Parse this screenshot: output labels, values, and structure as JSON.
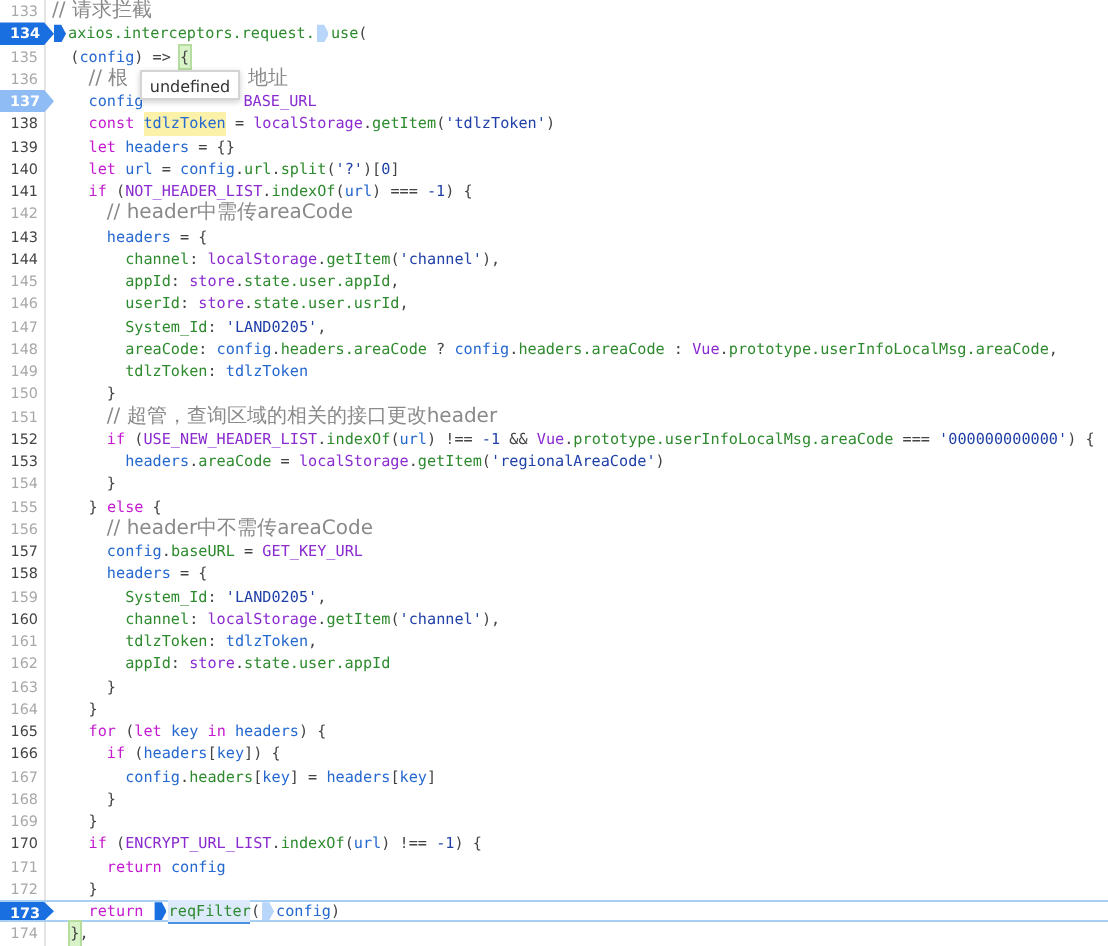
{
  "tooltip": {
    "text": "undefined"
  },
  "lines": [
    {
      "number": "133",
      "executable": false,
      "breakpoint": false,
      "current": false,
      "tokens": [
        {
          "kind": "c",
          "text": "// 请求拦截"
        }
      ]
    },
    {
      "number": "134",
      "executable": true,
      "breakpoint": true,
      "disabled": false,
      "current": false,
      "tokens": [
        {
          "kind": "marker",
          "on": true
        },
        {
          "kind": "p",
          "text": "axios.interceptors.request."
        },
        {
          "kind": "marker",
          "on": false
        },
        {
          "kind": "p",
          "text": "use"
        },
        {
          "kind": "o",
          "text": "("
        }
      ],
      "children": [
        {
          "number": "135",
          "executable": false,
          "breakpoint": false,
          "current": false,
          "tokens": [
            {
              "kind": "o",
              "text": "("
            },
            {
              "kind": "v",
              "text": "config"
            },
            {
              "kind": "o",
              "text": ") => "
            },
            {
              "kind": "bracket",
              "text": "{"
            }
          ],
          "children": [
            {
              "number": "136",
              "executable": false,
              "breakpoint": false,
              "current": false,
              "tokens": [
                {
                  "kind": "c",
                  "text": "// 根"
                },
                {
                  "kind": "gap"
                },
                {
                  "kind": "c",
                  "text": "地址"
                }
              ]
            },
            {
              "number": "137",
              "executable": true,
              "breakpoint": true,
              "disabled": true,
              "current": false,
              "tokens": [
                {
                  "kind": "v",
                  "text": "config"
                },
                {
                  "kind": "gap"
                },
                {
                  "kind": "g",
                  "text": "BASE_URL"
                }
              ]
            },
            {
              "number": "138",
              "executable": true,
              "breakpoint": false,
              "current": false,
              "tokens": [
                {
                  "kind": "k",
                  "text": "const "
                },
                {
                  "kind": "occurrence",
                  "text": "tdlzToken"
                },
                {
                  "kind": "o",
                  "text": " = "
                },
                {
                  "kind": "g",
                  "text": "localStorage"
                },
                {
                  "kind": "o",
                  "text": "."
                },
                {
                  "kind": "p",
                  "text": "getItem"
                },
                {
                  "kind": "o",
                  "text": "("
                },
                {
                  "kind": "s",
                  "text": "'tdlzToken'"
                },
                {
                  "kind": "o",
                  "text": ")"
                }
              ]
            },
            {
              "number": "139",
              "executable": true,
              "breakpoint": false,
              "current": false,
              "tokens": [
                {
                  "kind": "k",
                  "text": "let "
                },
                {
                  "kind": "v",
                  "text": "headers"
                },
                {
                  "kind": "o",
                  "text": " = {}"
                }
              ]
            },
            {
              "number": "140",
              "executable": true,
              "breakpoint": false,
              "current": false,
              "tokens": [
                {
                  "kind": "k",
                  "text": "let "
                },
                {
                  "kind": "v",
                  "text": "url"
                },
                {
                  "kind": "o",
                  "text": " = "
                },
                {
                  "kind": "v",
                  "text": "config"
                },
                {
                  "kind": "o",
                  "text": "."
                },
                {
                  "kind": "p",
                  "text": "url"
                },
                {
                  "kind": "o",
                  "text": "."
                },
                {
                  "kind": "p",
                  "text": "split"
                },
                {
                  "kind": "o",
                  "text": "("
                },
                {
                  "kind": "s",
                  "text": "'?'"
                },
                {
                  "kind": "o",
                  "text": ")["
                },
                {
                  "kind": "n",
                  "text": "0"
                },
                {
                  "kind": "o",
                  "text": "]"
                }
              ]
            },
            {
              "number": "141",
              "executable": true,
              "breakpoint": false,
              "current": false,
              "tokens": [
                {
                  "kind": "k",
                  "text": "if "
                },
                {
                  "kind": "o",
                  "text": "("
                },
                {
                  "kind": "g",
                  "text": "NOT_HEADER_LIST"
                },
                {
                  "kind": "o",
                  "text": "."
                },
                {
                  "kind": "p",
                  "text": "indexOf"
                },
                {
                  "kind": "o",
                  "text": "("
                },
                {
                  "kind": "v",
                  "text": "url"
                },
                {
                  "kind": "o",
                  "text": ") === "
                },
                {
                  "kind": "n",
                  "text": "-1"
                },
                {
                  "kind": "o",
                  "text": ") {"
                }
              ],
              "children": [
                {
                  "number": "142",
                  "executable": false,
                  "breakpoint": false,
                  "current": false,
                  "tokens": [
                    {
                      "kind": "c",
                      "text": "// header中需传areaCode"
                    }
                  ]
                },
                {
                  "number": "143",
                  "executable": true,
                  "breakpoint": false,
                  "current": false,
                  "tokens": [
                    {
                      "kind": "v",
                      "text": "headers"
                    },
                    {
                      "kind": "o",
                      "text": " = {"
                    }
                  ],
                  "children": [
                    {
                      "number": "144",
                      "executable": true,
                      "breakpoint": false,
                      "current": false,
                      "tokens": [
                        {
                          "kind": "p",
                          "text": "channel"
                        },
                        {
                          "kind": "o",
                          "text": ": "
                        },
                        {
                          "kind": "g",
                          "text": "localStorage"
                        },
                        {
                          "kind": "o",
                          "text": "."
                        },
                        {
                          "kind": "p",
                          "text": "getItem"
                        },
                        {
                          "kind": "o",
                          "text": "("
                        },
                        {
                          "kind": "s",
                          "text": "'channel'"
                        },
                        {
                          "kind": "o",
                          "text": "),"
                        }
                      ]
                    },
                    {
                      "number": "145",
                      "executable": false,
                      "breakpoint": false,
                      "current": false,
                      "tokens": [
                        {
                          "kind": "p",
                          "text": "appId"
                        },
                        {
                          "kind": "o",
                          "text": ": "
                        },
                        {
                          "kind": "g",
                          "text": "store"
                        },
                        {
                          "kind": "o",
                          "text": "."
                        },
                        {
                          "kind": "p",
                          "text": "state.user.appId"
                        },
                        {
                          "kind": "o",
                          "text": ","
                        }
                      ]
                    },
                    {
                      "number": "146",
                      "executable": false,
                      "breakpoint": false,
                      "current": false,
                      "tokens": [
                        {
                          "kind": "p",
                          "text": "userId"
                        },
                        {
                          "kind": "o",
                          "text": ": "
                        },
                        {
                          "kind": "g",
                          "text": "store"
                        },
                        {
                          "kind": "o",
                          "text": "."
                        },
                        {
                          "kind": "p",
                          "text": "state.user.usrId"
                        },
                        {
                          "kind": "o",
                          "text": ","
                        }
                      ]
                    },
                    {
                      "number": "147",
                      "executable": false,
                      "breakpoint": false,
                      "current": false,
                      "tokens": [
                        {
                          "kind": "p",
                          "text": "System_Id"
                        },
                        {
                          "kind": "o",
                          "text": ": "
                        },
                        {
                          "kind": "s",
                          "text": "'LAND0205'"
                        },
                        {
                          "kind": "o",
                          "text": ","
                        }
                      ]
                    },
                    {
                      "number": "148",
                      "executable": false,
                      "breakpoint": false,
                      "current": false,
                      "tokens": [
                        {
                          "kind": "p",
                          "text": "areaCode"
                        },
                        {
                          "kind": "o",
                          "text": ": "
                        },
                        {
                          "kind": "v",
                          "text": "config"
                        },
                        {
                          "kind": "o",
                          "text": "."
                        },
                        {
                          "kind": "p",
                          "text": "headers.areaCode"
                        },
                        {
                          "kind": "o",
                          "text": " ? "
                        },
                        {
                          "kind": "v",
                          "text": "config"
                        },
                        {
                          "kind": "o",
                          "text": "."
                        },
                        {
                          "kind": "p",
                          "text": "headers.areaCode"
                        },
                        {
                          "kind": "o",
                          "text": " : "
                        },
                        {
                          "kind": "g",
                          "text": "Vue"
                        },
                        {
                          "kind": "o",
                          "text": "."
                        },
                        {
                          "kind": "p",
                          "text": "prototype.userInfoLocalMsg.areaCode"
                        },
                        {
                          "kind": "o",
                          "text": ","
                        }
                      ]
                    },
                    {
                      "number": "149",
                      "executable": false,
                      "breakpoint": false,
                      "current": false,
                      "tokens": [
                        {
                          "kind": "p",
                          "text": "tdlzToken"
                        },
                        {
                          "kind": "o",
                          "text": ": "
                        },
                        {
                          "kind": "v",
                          "text": "tdlzToken"
                        }
                      ]
                    }
                  ]
                },
                {
                  "number": "150",
                  "executable": false,
                  "breakpoint": false,
                  "current": false,
                  "tokens": [
                    {
                      "kind": "o",
                      "text": "}"
                    }
                  ]
                },
                {
                  "number": "151",
                  "executable": false,
                  "breakpoint": false,
                  "current": false,
                  "tokens": [
                    {
                      "kind": "c",
                      "text": "// 超管，查询区域的相关的接口更改header"
                    }
                  ]
                },
                {
                  "number": "152",
                  "executable": true,
                  "breakpoint": false,
                  "current": false,
                  "tokens": [
                    {
                      "kind": "k",
                      "text": "if "
                    },
                    {
                      "kind": "o",
                      "text": "("
                    },
                    {
                      "kind": "g",
                      "text": "USE_NEW_HEADER_LIST"
                    },
                    {
                      "kind": "o",
                      "text": "."
                    },
                    {
                      "kind": "p",
                      "text": "indexOf"
                    },
                    {
                      "kind": "o",
                      "text": "("
                    },
                    {
                      "kind": "v",
                      "text": "url"
                    },
                    {
                      "kind": "o",
                      "text": ") !== "
                    },
                    {
                      "kind": "n",
                      "text": "-1"
                    },
                    {
                      "kind": "o",
                      "text": " && "
                    },
                    {
                      "kind": "g",
                      "text": "Vue"
                    },
                    {
                      "kind": "o",
                      "text": "."
                    },
                    {
                      "kind": "p",
                      "text": "prototype.userInfoLocalMsg.areaCode"
                    },
                    {
                      "kind": "o",
                      "text": " === "
                    },
                    {
                      "kind": "s",
                      "text": "'000000000000'"
                    },
                    {
                      "kind": "o",
                      "text": ") {"
                    }
                  ],
                  "children": [
                    {
                      "number": "153",
                      "executable": true,
                      "breakpoint": false,
                      "current": false,
                      "tokens": [
                        {
                          "kind": "v",
                          "text": "headers"
                        },
                        {
                          "kind": "o",
                          "text": "."
                        },
                        {
                          "kind": "p",
                          "text": "areaCode"
                        },
                        {
                          "kind": "o",
                          "text": " = "
                        },
                        {
                          "kind": "g",
                          "text": "localStorage"
                        },
                        {
                          "kind": "o",
                          "text": "."
                        },
                        {
                          "kind": "p",
                          "text": "getItem"
                        },
                        {
                          "kind": "o",
                          "text": "("
                        },
                        {
                          "kind": "s",
                          "text": "'regionalAreaCode'"
                        },
                        {
                          "kind": "o",
                          "text": ")"
                        }
                      ]
                    }
                  ]
                },
                {
                  "number": "154",
                  "executable": false,
                  "breakpoint": false,
                  "current": false,
                  "tokens": [
                    {
                      "kind": "o",
                      "text": "}"
                    }
                  ]
                }
              ]
            },
            {
              "number": "155",
              "executable": false,
              "breakpoint": false,
              "current": false,
              "tokens": [
                {
                  "kind": "o",
                  "text": "} "
                },
                {
                  "kind": "k",
                  "text": "else"
                },
                {
                  "kind": "o",
                  "text": " {"
                }
              ],
              "children": [
                {
                  "number": "156",
                  "executable": false,
                  "breakpoint": false,
                  "current": false,
                  "tokens": [
                    {
                      "kind": "c",
                      "text": "// header中不需传areaCode"
                    }
                  ]
                },
                {
                  "number": "157",
                  "executable": true,
                  "breakpoint": false,
                  "current": false,
                  "tokens": [
                    {
                      "kind": "v",
                      "text": "config"
                    },
                    {
                      "kind": "o",
                      "text": "."
                    },
                    {
                      "kind": "p",
                      "text": "baseURL"
                    },
                    {
                      "kind": "o",
                      "text": " = "
                    },
                    {
                      "kind": "g",
                      "text": "GET_KEY_URL"
                    }
                  ]
                },
                {
                  "number": "158",
                  "executable": true,
                  "breakpoint": false,
                  "current": false,
                  "tokens": [
                    {
                      "kind": "v",
                      "text": "headers"
                    },
                    {
                      "kind": "o",
                      "text": " = {"
                    }
                  ],
                  "children": [
                    {
                      "number": "159",
                      "executable": false,
                      "breakpoint": false,
                      "current": false,
                      "tokens": [
                        {
                          "kind": "p",
                          "text": "System_Id"
                        },
                        {
                          "kind": "o",
                          "text": ": "
                        },
                        {
                          "kind": "s",
                          "text": "'LAND0205'"
                        },
                        {
                          "kind": "o",
                          "text": ","
                        }
                      ]
                    },
                    {
                      "number": "160",
                      "executable": true,
                      "breakpoint": false,
                      "current": false,
                      "tokens": [
                        {
                          "kind": "p",
                          "text": "channel"
                        },
                        {
                          "kind": "o",
                          "text": ": "
                        },
                        {
                          "kind": "g",
                          "text": "localStorage"
                        },
                        {
                          "kind": "o",
                          "text": "."
                        },
                        {
                          "kind": "p",
                          "text": "getItem"
                        },
                        {
                          "kind": "o",
                          "text": "("
                        },
                        {
                          "kind": "s",
                          "text": "'channel'"
                        },
                        {
                          "kind": "o",
                          "text": "),"
                        }
                      ]
                    },
                    {
                      "number": "161",
                      "executable": false,
                      "breakpoint": false,
                      "current": false,
                      "tokens": [
                        {
                          "kind": "p",
                          "text": "tdlzToken"
                        },
                        {
                          "kind": "o",
                          "text": ": "
                        },
                        {
                          "kind": "v",
                          "text": "tdlzToken"
                        },
                        {
                          "kind": "o",
                          "text": ","
                        }
                      ]
                    },
                    {
                      "number": "162",
                      "executable": false,
                      "breakpoint": false,
                      "current": false,
                      "tokens": [
                        {
                          "kind": "p",
                          "text": "appId"
                        },
                        {
                          "kind": "o",
                          "text": ": "
                        },
                        {
                          "kind": "g",
                          "text": "store"
                        },
                        {
                          "kind": "o",
                          "text": "."
                        },
                        {
                          "kind": "p",
                          "text": "state.user.appId"
                        }
                      ]
                    }
                  ]
                },
                {
                  "number": "163",
                  "executable": false,
                  "breakpoint": false,
                  "current": false,
                  "tokens": [
                    {
                      "kind": "o",
                      "text": "}"
                    }
                  ]
                }
              ]
            },
            {
              "number": "164",
              "executable": false,
              "breakpoint": false,
              "current": false,
              "tokens": [
                {
                  "kind": "o",
                  "text": "}"
                }
              ]
            },
            {
              "number": "165",
              "executable": true,
              "breakpoint": false,
              "current": false,
              "tokens": [
                {
                  "kind": "k",
                  "text": "for "
                },
                {
                  "kind": "o",
                  "text": "("
                },
                {
                  "kind": "k",
                  "text": "let "
                },
                {
                  "kind": "v",
                  "text": "key"
                },
                {
                  "kind": "k",
                  "text": " in "
                },
                {
                  "kind": "v",
                  "text": "headers"
                },
                {
                  "kind": "o",
                  "text": ") {"
                }
              ],
              "children": [
                {
                  "number": "166",
                  "executable": true,
                  "breakpoint": false,
                  "current": false,
                  "tokens": [
                    {
                      "kind": "k",
                      "text": "if "
                    },
                    {
                      "kind": "o",
                      "text": "("
                    },
                    {
                      "kind": "v",
                      "text": "headers"
                    },
                    {
                      "kind": "o",
                      "text": "["
                    },
                    {
                      "kind": "v",
                      "text": "key"
                    },
                    {
                      "kind": "o",
                      "text": "]) {"
                    }
                  ],
                  "children": [
                    {
                      "number": "167",
                      "executable": false,
                      "breakpoint": false,
                      "current": false,
                      "tokens": [
                        {
                          "kind": "v",
                          "text": "config"
                        },
                        {
                          "kind": "o",
                          "text": "."
                        },
                        {
                          "kind": "p",
                          "text": "headers"
                        },
                        {
                          "kind": "o",
                          "text": "["
                        },
                        {
                          "kind": "v",
                          "text": "key"
                        },
                        {
                          "kind": "o",
                          "text": "] = "
                        },
                        {
                          "kind": "v",
                          "text": "headers"
                        },
                        {
                          "kind": "o",
                          "text": "["
                        },
                        {
                          "kind": "v",
                          "text": "key"
                        },
                        {
                          "kind": "o",
                          "text": "]"
                        }
                      ]
                    }
                  ]
                },
                {
                  "number": "168",
                  "executable": false,
                  "breakpoint": false,
                  "current": false,
                  "tokens": [
                    {
                      "kind": "o",
                      "text": "}"
                    }
                  ]
                }
              ]
            },
            {
              "number": "169",
              "executable": false,
              "breakpoint": false,
              "current": false,
              "tokens": [
                {
                  "kind": "o",
                  "text": "}"
                }
              ]
            },
            {
              "number": "170",
              "executable": true,
              "breakpoint": false,
              "current": false,
              "tokens": [
                {
                  "kind": "k",
                  "text": "if "
                },
                {
                  "kind": "o",
                  "text": "("
                },
                {
                  "kind": "g",
                  "text": "ENCRYPT_URL_LIST"
                },
                {
                  "kind": "o",
                  "text": "."
                },
                {
                  "kind": "p",
                  "text": "indexOf"
                },
                {
                  "kind": "o",
                  "text": "("
                },
                {
                  "kind": "v",
                  "text": "url"
                },
                {
                  "kind": "o",
                  "text": ") !== "
                },
                {
                  "kind": "n",
                  "text": "-1"
                },
                {
                  "kind": "o",
                  "text": ") {"
                }
              ],
              "children": [
                {
                  "number": "171",
                  "executable": false,
                  "breakpoint": false,
                  "current": false,
                  "tokens": [
                    {
                      "kind": "k",
                      "text": "return "
                    },
                    {
                      "kind": "v",
                      "text": "config"
                    }
                  ]
                }
              ]
            },
            {
              "number": "172",
              "executable": false,
              "breakpoint": false,
              "current": false,
              "tokens": [
                {
                  "kind": "o",
                  "text": "}"
                }
              ]
            },
            {
              "number": "173",
              "executable": true,
              "breakpoint": true,
              "disabled": false,
              "current": true,
              "tokens": [
                {
                  "kind": "k",
                  "text": "return "
                },
                {
                  "kind": "marker",
                  "on": true
                },
                {
                  "kind": "call",
                  "text": "reqFilter"
                },
                {
                  "kind": "o",
                  "text": "("
                },
                {
                  "kind": "marker",
                  "on": false
                },
                {
                  "kind": "v",
                  "text": "config"
                },
                {
                  "kind": "o",
                  "text": ")"
                }
              ]
            }
          ]
        },
        {
          "number": "174",
          "executable": false,
          "breakpoint": false,
          "current": false,
          "tokens": [
            {
              "kind": "bracket",
              "text": "}"
            },
            {
              "kind": "o",
              "text": ","
            }
          ]
        }
      ]
    }
  ]
}
